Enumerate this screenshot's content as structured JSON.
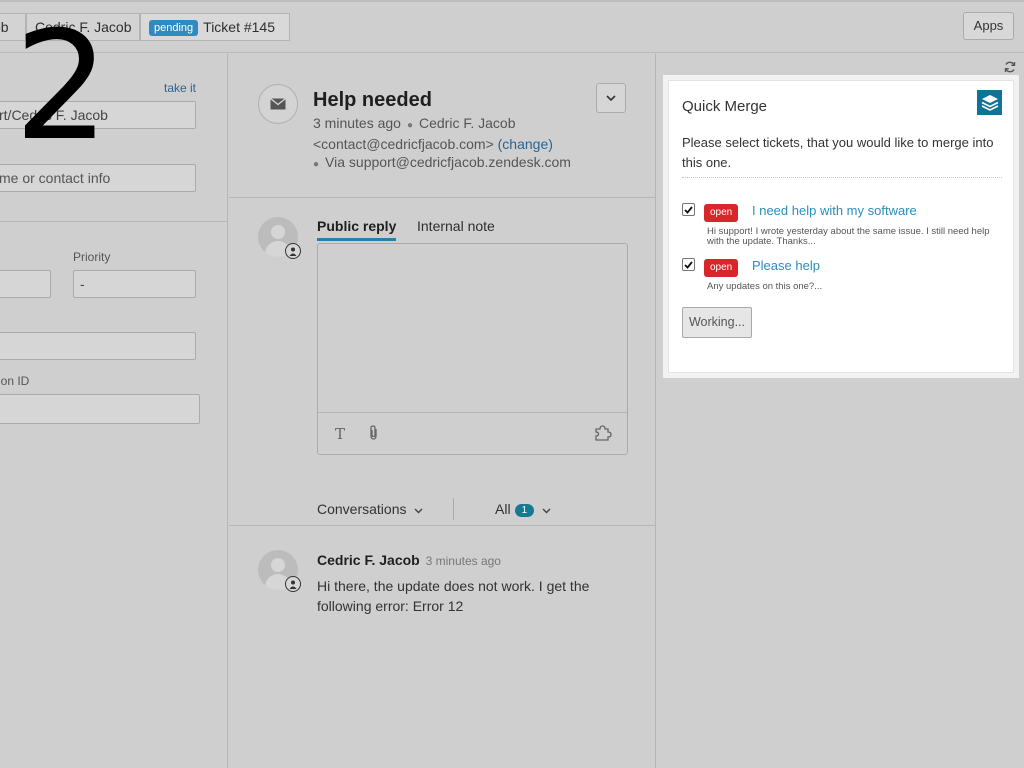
{
  "topbar": {
    "tabs": [
      {
        "label": "ob"
      },
      {
        "label": "Cedric F. Jacob"
      },
      {
        "status": "pending",
        "label": "Ticket #145"
      }
    ],
    "apps_label": "Apps"
  },
  "overlay": {
    "step_number": "2"
  },
  "left": {
    "take_it": "take it",
    "requester_value": "rt/Cedric F. Jacob",
    "cc_placeholder": "me or contact info",
    "priority_label": "Priority",
    "priority_value": "-",
    "id_label": "ion ID"
  },
  "ticket": {
    "subject": "Help needed",
    "time": "3 minutes ago",
    "author": "Cedric F. Jacob",
    "email": "<contact@cedricfjacob.com>",
    "change_link": "(change)",
    "via": "Via support@cedricfjacob.zendesk.com"
  },
  "reply": {
    "tabs": [
      {
        "label": "Public reply"
      },
      {
        "label": "Internal note"
      }
    ],
    "text_icon": "T"
  },
  "conversations": {
    "label": "Conversations",
    "filter_label": "All",
    "count": "1"
  },
  "comment": {
    "author": "Cedric F. Jacob",
    "time": "3 minutes ago",
    "body": "Hi there, the update does not work. I get the following error: Error 12"
  },
  "quick_merge": {
    "title": "Quick Merge",
    "description": "Please select tickets, that you would like to merge into this one.",
    "tickets": [
      {
        "checked": true,
        "status": "open",
        "title": "I need help with my software",
        "preview": "Hi support! I wrote yesterday about the same issue. I still need help with the update. Thanks..."
      },
      {
        "checked": true,
        "status": "open",
        "title": "Please help",
        "preview": "Any updates on this one?..."
      }
    ],
    "button_label": "Working..."
  },
  "colors": {
    "pending": "#2e8bc0",
    "open": "#d9262b",
    "link": "#2d8dbb",
    "brand": "#0f7395"
  },
  "icons": [
    "mail-icon",
    "chevron-down-icon",
    "text-format-icon",
    "paperclip-icon",
    "puzzle-icon",
    "refresh-icon",
    "stack-logo-icon",
    "checkmark-icon",
    "user-icon"
  ]
}
